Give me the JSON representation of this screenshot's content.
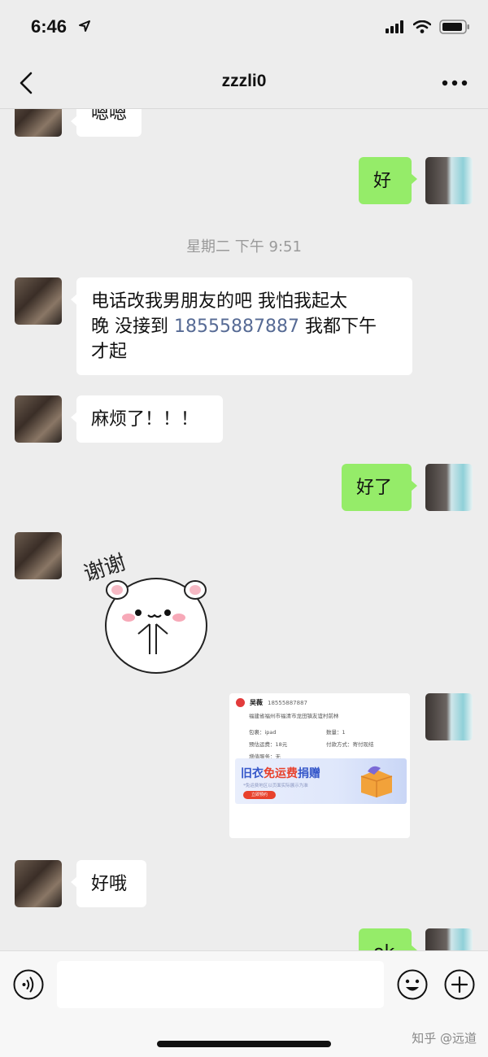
{
  "status": {
    "time": "6:46"
  },
  "header": {
    "title": "zzzli0"
  },
  "messages": {
    "m1": "嗯嗯",
    "m2": "好",
    "timestamp": "星期二 下午 9:51",
    "m3_line1": "电话改我男朋友的吧 我怕我起太",
    "m3_line2_pre": "晚 没接到 ",
    "m3_phone": "18555887887",
    "m3_line2_post": " 我都下午",
    "m3_line3": "才起",
    "m4": "麻烦了！！！",
    "m5": "好了",
    "sticker_text": "谢谢",
    "m7": "好哦",
    "m8_partial": "ok"
  },
  "card": {
    "name": "吴薇",
    "phone": "18555887887",
    "address": "福建省福州市福清市龙田镇友谊村前林",
    "item_label": "包裹：",
    "item_value": "ipad",
    "qty_label": "数量：",
    "qty_value": "1",
    "fee_label": "预估运费：",
    "fee_value": "18元",
    "pay_label": "付款方式：",
    "pay_value": "寄付现结",
    "extra_label": "增值服务：",
    "extra_value": "无",
    "banner_pre": "旧衣",
    "banner_hl": "免运费",
    "banner_post": "捐赠",
    "banner_sub": "*免运费地区以页面实际展示为准",
    "banner_btn": "立即预约"
  },
  "input": {
    "placeholder": ""
  },
  "watermark": "知乎 @远道",
  "colors": {
    "background": "#ededed",
    "bubble_out": "#95ec69",
    "bubble_in": "#ffffff",
    "link": "#576b95"
  },
  "icons": [
    "location-arrow-icon",
    "signal-icon",
    "wifi-icon",
    "battery-icon",
    "back-chevron-icon",
    "more-dots-icon",
    "voice-icon",
    "emoji-icon",
    "plus-icon"
  ]
}
